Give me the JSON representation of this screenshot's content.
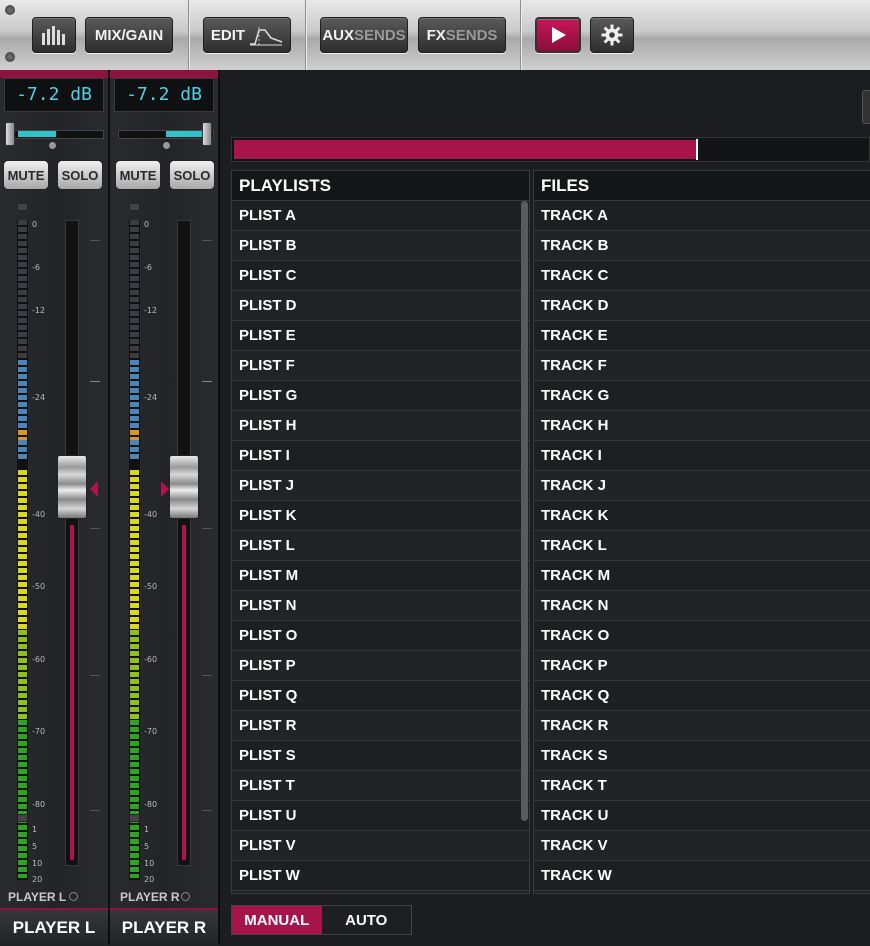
{
  "toolbar": {
    "meters_icon": "bar-meters-icon",
    "mix_gain": "MIX/GAIN",
    "edit": "EDIT",
    "edit_icon": "eq-curve-icon",
    "aux_a": "AUX",
    "aux_b": "SENDS",
    "fx_a": "FX",
    "fx_b": "SENDS",
    "play_icon": "play-icon",
    "settings_icon": "gear-icon",
    "accent": "#c7185a"
  },
  "channels": [
    {
      "name": "PLAYER L",
      "footer": "PLAYER L",
      "gain_readout": "-7.2 dB",
      "mute": "MUTE",
      "solo": "SOLO",
      "scale": [
        "0",
        "-6",
        "-12",
        "-24",
        "-40",
        "-50",
        "-60",
        "-70",
        "-80",
        "1",
        "5",
        "10",
        "20"
      ]
    },
    {
      "name": "PLAYER R",
      "footer": "PLAYER R",
      "gain_readout": "-7.2 dB",
      "mute": "MUTE",
      "solo": "SOLO",
      "scale": [
        "0",
        "-6",
        "-12",
        "-24",
        "-40",
        "-50",
        "-60",
        "-70",
        "-80",
        "1",
        "5",
        "10",
        "20"
      ]
    }
  ],
  "progress": {
    "fraction": 0.73,
    "color": "#a61449"
  },
  "playlists": {
    "header": "PLAYLISTS",
    "items": [
      "PLIST A",
      "PLIST B",
      "PLIST C",
      "PLIST D",
      "PLIST E",
      "PLIST F",
      "PLIST G",
      "PLIST H",
      "PLIST I",
      "PLIST J",
      "PLIST K",
      "PLIST L",
      "PLIST M",
      "PLIST N",
      "PLIST O",
      "PLIST P",
      "PLIST Q",
      "PLIST R",
      "PLIST S",
      "PLIST T",
      "PLIST U",
      "PLIST V",
      "PLIST W"
    ]
  },
  "files": {
    "header": "FILES",
    "items": [
      "TRACK A",
      "TRACK B",
      "TRACK C",
      "TRACK D",
      "TRACK E",
      "TRACK F",
      "TRACK G",
      "TRACK H",
      "TRACK I",
      "TRACK J",
      "TRACK K",
      "TRACK L",
      "TRACK M",
      "TRACK N",
      "TRACK O",
      "TRACK P",
      "TRACK Q",
      "TRACK R",
      "TRACK S",
      "TRACK T",
      "TRACK U",
      "TRACK V",
      "TRACK W"
    ]
  },
  "mode": {
    "manual": "MANUAL",
    "auto": "AUTO",
    "selected": "MANUAL"
  }
}
